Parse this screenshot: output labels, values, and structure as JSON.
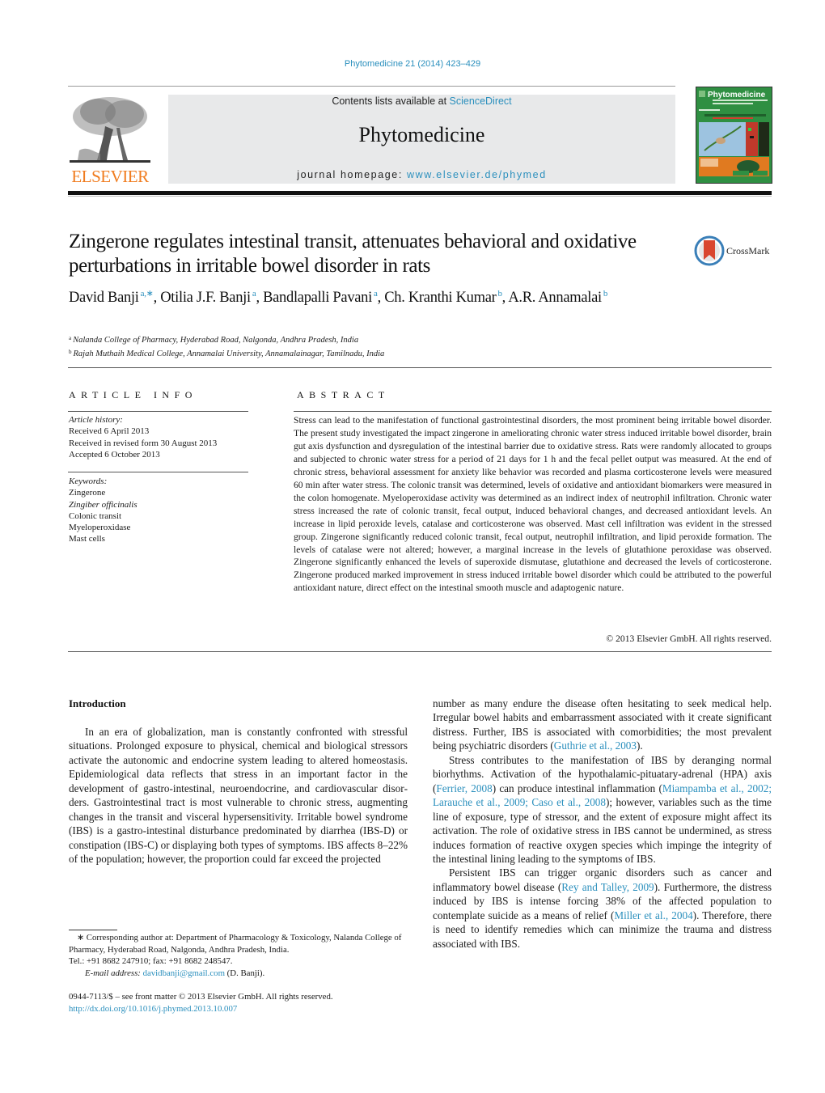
{
  "header": {
    "citation": "Phytomedicine 21 (2014) 423–429",
    "contents_prefix": "Contents lists available at ",
    "contents_link": "ScienceDirect",
    "journal_name": "Phytomedicine",
    "homepage_prefix": "journal homepage: ",
    "homepage_link": "www.elsevier.de/phymed",
    "publisher_logo_text": "ELSEVIER",
    "cover_title": "Phytomedicine",
    "crossmark_label": "CrossMark"
  },
  "colors": {
    "link": "#2a8fbd",
    "elsevier_orange": "#f07c1f",
    "banner_gray": "#e8e9ea",
    "cover_green": "#2b8c3e",
    "crossmark_red": "#d9462f"
  },
  "article": {
    "title": "Zingerone regulates intestinal transit, attenuates behavioral and oxidative perturbations in irritable bowel disorder in rats",
    "authors": [
      {
        "name": "David Banji",
        "sup": "a,∗"
      },
      {
        "name": "Otilia J.F. Banji",
        "sup": "a"
      },
      {
        "name": "Bandlapalli Pavani",
        "sup": "a"
      },
      {
        "name": "Ch. Kranthi Kumar",
        "sup": "b"
      },
      {
        "name": "A.R. Annamalai",
        "sup": "b"
      }
    ],
    "affiliations": [
      {
        "mark": "a",
        "text": "Nalanda College of Pharmacy, Hyderabad Road, Nalgonda, Andhra Pradesh, India"
      },
      {
        "mark": "b",
        "text": "Rajah Muthaih Medical College, Annamalai University, Annamalainagar, Tamilnadu, India"
      }
    ]
  },
  "article_info": {
    "heading": "ARTICLE INFO",
    "history_label": "Article history:",
    "history": [
      "Received 6 April 2013",
      "Received in revised form 30 August 2013",
      "Accepted 6 October 2013"
    ],
    "keywords_label": "Keywords:",
    "keywords": [
      {
        "text": "Zingerone",
        "italic": false
      },
      {
        "text": "Zingiber officinalis",
        "italic": true
      },
      {
        "text": "Colonic transit",
        "italic": false
      },
      {
        "text": "Myeloperoxidase",
        "italic": false
      },
      {
        "text": "Mast cells",
        "italic": false
      }
    ]
  },
  "abstract": {
    "heading": "ABSTRACT",
    "text": "Stress can lead to the manifestation of functional gastrointestinal disorders, the most prominent being irritable bowel disorder. The present study investigated the impact zingerone in ameliorating chronic water stress induced irritable bowel disorder, brain gut axis dysfunction and dysregulation of the intesti­nal barrier due to oxidative stress. Rats were randomly allocated to groups and subjected to chronic water stress for a period of 21 days for 1 h and the fecal pellet output was measured. At the end of chronic stress, behavioral assessment for anxiety like behavior was recorded and plasma corticosterone levels were measured 60 min after water stress. The colonic transit was determined, levels of oxida­tive and antioxidant biomarkers were measured in the colon homogenate. Myeloperoxidase activity was determined as an indirect index of neutrophil infiltration. Chronic water stress increased the rate of colonic transit, fecal output, induced behavioral changes, and decreased antioxidant levels. An increase in lipid peroxide levels, catalase and corticosterone was observed. Mast cell infiltration was evident in the stressed group. Zingerone significantly reduced colonic transit, fecal output, neutrophil infiltration, and lipid peroxide formation. The levels of catalase were not altered; however, a marginal increase in the levels of glutathione peroxidase was observed. Zingerone significantly enhanced the levels of superoxide dismutase, glutathione and decreased the levels of corticosterone. Zingerone produced marked improve­ment in stress induced irritable bowel disorder which could be attributed to the powerful antioxidant nature, direct effect on the intestinal smooth muscle and adaptogenic nature.",
    "copyright": "© 2013 Elsevier GmbH. All rights reserved."
  },
  "introduction": {
    "heading": "Introduction",
    "left_para_1": "In an era of globalization, man is constantly confronted with stressful situations. Prolonged exposure to physical, chemical and biological stressors activate the autonomic and endocrine system leading to altered homeostasis. Epidemiological data reflects that stress in an important factor in the development of gastro-intestinal, neuroendocrine, and cardiovascular disor­ders. Gastrointestinal tract is most vulnerable to chronic stress, augmenting changes in the transit and visceral hypersensitivity. Irritable bowel syndrome (IBS) is a gastro-intestinal disturbance predominated by diarrhea (IBS-D) or constipation (IBS-C) or displaying both types of symptoms. IBS affects 8–22% of the pop­ulation; however, the proportion could far exceed the projected",
    "right_para_1_a": "number as many endure the disease often hesitating to seek medi­cal help. Irregular bowel habits and embarrassment associated with it create significant distress. Further, IBS is associated with comor­bidities; the most prevalent being psychiatric disorders (",
    "right_para_1_ref": "Guthrie et al., 2003",
    "right_para_1_b": ").",
    "right_para_2_a": "Stress contributes to the manifestation of IBS by deranging nor­mal biorhythms. Activation of the hypothalamic-pituatary-adrenal (HPA) axis (",
    "right_para_2_ref1": "Ferrier, 2008",
    "right_para_2_b": ") can produce intestinal inflammation (",
    "right_para_2_ref2": "Miampamba et al., 2002; Larauche et al., 2009; Caso et al., 2008",
    "right_para_2_c": "); however, variables such as the time line of exposure, type of stressor, and the extent of exposure might affect its activation. The role of oxidative stress in IBS cannot be undermined, as stress induces formation of reactive oxygen species which impinge the integrity of the intestinal lining leading to the symptoms of IBS.",
    "right_para_3_a": "Persistent IBS can trigger organic disorders such as cancer and inflammatory bowel disease (",
    "right_para_3_ref1": "Rey and Talley, 2009",
    "right_para_3_b": "). Further­more, the distress induced by IBS is intense forcing 38% of the affected population to contemplate suicide as a means of relief (",
    "right_para_3_ref2": "Miller et al., 2004",
    "right_para_3_c": "). Therefore, there is need to identify remedies which can minimize the trauma and distress associated with IBS."
  },
  "footnotes": {
    "corresponding": "∗  Corresponding author at: Department of Pharmacology & Toxicology, Nalanda College of Pharmacy, Hyderabad Road, Nalgonda, Andhra Pradesh, India.",
    "tel": "Tel.: +91 8682 247910; fax: +91 8682 248547.",
    "email_label": "E-mail address: ",
    "email": "davidbanji@gmail.com",
    "email_suffix": " (D. Banji).",
    "front_matter": "0944-7113/$ – see front matter © 2013 Elsevier GmbH. All rights reserved.",
    "doi": "http://dx.doi.org/10.1016/j.phymed.2013.10.007"
  }
}
